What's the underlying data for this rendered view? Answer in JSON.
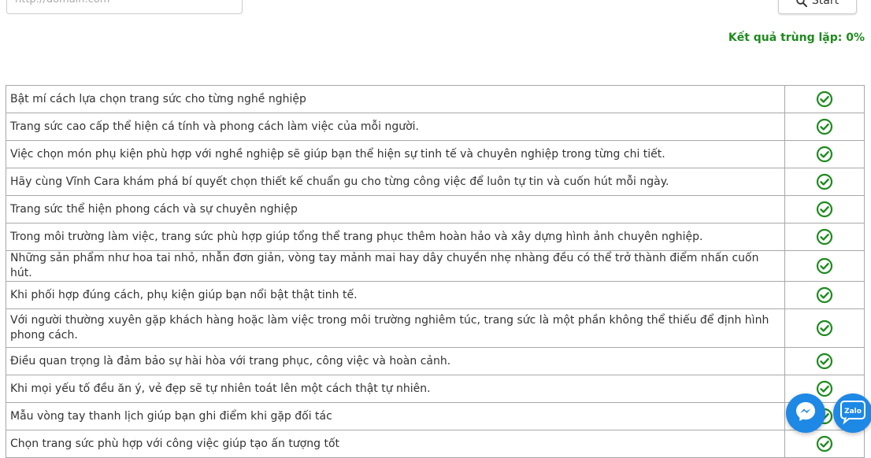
{
  "url_input": {
    "placeholder": "http://domain.com",
    "value": ""
  },
  "start_button": {
    "label": "Start",
    "icon": "search-icon"
  },
  "result": {
    "label": "Kết quả trùng lặp: 0%"
  },
  "colors": {
    "check": "#1f8a1f",
    "result_text": "#1f8a1f",
    "fab": "#1e88e5"
  },
  "rows": [
    {
      "text": "Bật mí cách lựa chọn trang sức cho từng nghề nghiệp",
      "status": "check-circle-icon"
    },
    {
      "text": "Trang sức cao cấp thể hiện cá tính và phong cách làm việc của mỗi người.",
      "status": "check-circle-icon"
    },
    {
      "text": "Việc chọn món phụ kiện phù hợp với nghề nghiệp sẽ giúp bạn thể hiện sự tinh tế và chuyên nghiệp trong từng chi tiết.",
      "status": "check-circle-icon"
    },
    {
      "text": "Hãy cùng Vĩnh Cara khám phá bí quyết chọn thiết kế chuẩn gu cho từng công việc để luôn tự tin và cuốn hút mỗi ngày.",
      "status": "check-circle-icon"
    },
    {
      "text": "Trang sức thể hiện phong cách và sự chuyên nghiệp",
      "status": "check-circle-icon"
    },
    {
      "text": "Trong môi trường làm việc, trang sức phù hợp giúp tổng thể trang phục thêm hoàn hảo và xây dựng hình ảnh chuyên nghiệp.",
      "status": "check-circle-icon"
    },
    {
      "text": "Những sản phẩm như hoa tai nhỏ, nhẫn đơn giản, vòng tay mảnh mai hay dây chuyền nhẹ nhàng đều có thể trở thành điểm nhấn cuốn hút.",
      "status": "check-circle-icon"
    },
    {
      "text": "Khi phối hợp đúng cách, phụ kiện giúp bạn nổi bật thật tinh tế.",
      "status": "check-circle-icon"
    },
    {
      "text": "Với người thường xuyên gặp khách hàng hoặc làm việc trong môi trường nghiêm túc, trang sức là một phần không thể thiếu để định hình phong cách.",
      "status": "check-circle-icon"
    },
    {
      "text": "Điều quan trọng là đảm bảo sự hài hòa với trang phục, công việc và hoàn cảnh.",
      "status": "check-circle-icon"
    },
    {
      "text": "Khi mọi yếu tố đều ăn ý, vẻ đẹp sẽ tự nhiên toát lên một cách thật tự nhiên.",
      "status": "check-circle-icon"
    },
    {
      "text": "Mẫu vòng tay thanh lịch giúp bạn ghi điểm khi gặp đối tác",
      "status": "check-circle-icon"
    },
    {
      "text": "Chọn trang sức phù hợp với công việc giúp tạo ấn tượng tốt",
      "status": "check-circle-icon"
    }
  ],
  "floating_buttons": {
    "messenger_icon": "messenger-icon",
    "zalo_label": "Zalo"
  }
}
